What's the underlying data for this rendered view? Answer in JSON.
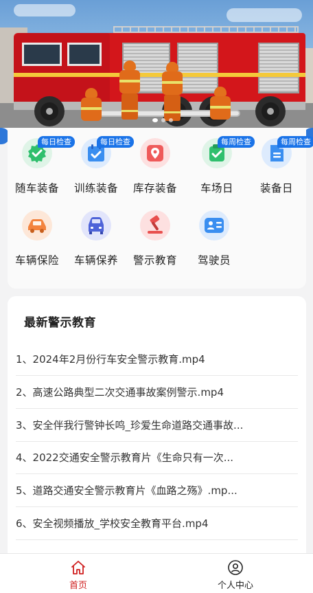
{
  "features": {
    "row1": [
      {
        "label": "随车装备",
        "badge": "每日检查",
        "icon": "checkmark-badge-icon",
        "color": "#2fbf6d"
      },
      {
        "label": "训练装备",
        "badge": "每日检查",
        "icon": "calendar-check-icon",
        "color": "#3a8ef0"
      },
      {
        "label": "库存装备",
        "badge": "",
        "icon": "location-pin-icon",
        "color": "#ef5a5a"
      },
      {
        "label": "车场日",
        "badge": "每周检查",
        "icon": "check-square-icon",
        "color": "#2fbf6d"
      },
      {
        "label": "装备日",
        "badge": "每周检查",
        "icon": "document-icon",
        "color": "#3a8ef0"
      }
    ],
    "row2": [
      {
        "label": "车辆保险",
        "icon": "car-insurance-icon",
        "color": "#f3833e"
      },
      {
        "label": "车辆保养",
        "icon": "car-maintenance-icon",
        "color": "#4e63d8"
      },
      {
        "label": "警示教育",
        "icon": "gavel-icon",
        "color": "#e8504e"
      },
      {
        "label": "驾驶员",
        "icon": "driver-id-card-icon",
        "color": "#3a8ef0"
      }
    ]
  },
  "education": {
    "title": "最新警示教育",
    "items": [
      "1、2024年2月份行车安全警示教育.mp4",
      "2、高速公路典型二次交通事故案例警示.mp4",
      "3、安全伴我行警钟长鸣_珍爱生命道路交通事故...",
      "4、2022交通安全警示教育片《生命只有一次...",
      "5、道路交通安全警示教育片《血路之殇》.mp...",
      "6、安全视频播放_学校安全教育平台.mp4"
    ]
  },
  "tabbar": {
    "home": {
      "label": "首页",
      "icon": "home-icon",
      "color": "#cf1f1f"
    },
    "profile": {
      "label": "个人中心",
      "icon": "user-circle-icon"
    }
  }
}
